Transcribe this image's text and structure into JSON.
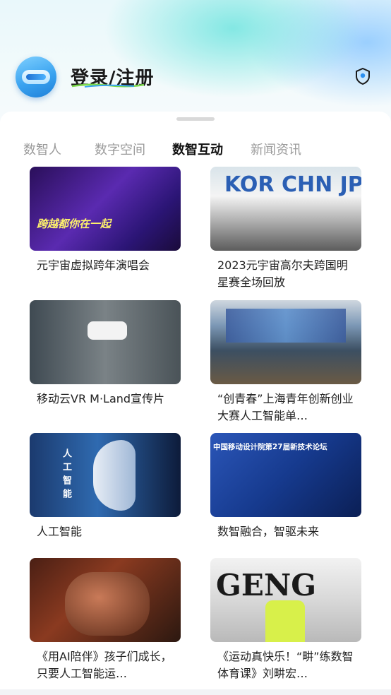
{
  "header": {
    "login_label": "登录/注册",
    "location_icon": "location-shield-icon",
    "avatar_icon": "vr-robot-avatar-icon"
  },
  "tabs": [
    {
      "label": "数智人",
      "active": false
    },
    {
      "label": "数字空间",
      "active": false
    },
    {
      "label": "数智互动",
      "active": true
    },
    {
      "label": "新闻资讯",
      "active": false
    }
  ],
  "cards": [
    {
      "title": "元宇宙虚拟跨年演唱会",
      "thumb_text": "跨越都你在一起"
    },
    {
      "title": "2023元宇宙高尔夫跨国明星赛全场回放",
      "thumb_text": "KOR  CHN  JPN"
    },
    {
      "title": "移动云VR M·Land宣传片",
      "thumb_text": ""
    },
    {
      "title": "“创青春”上海青年创新创业大赛人工智能单…",
      "thumb_text": ""
    },
    {
      "title": "人工智能",
      "thumb_text": "人工智能"
    },
    {
      "title": "数智融合，智驱未来",
      "thumb_text": "中国移动设计院第27届新技术论坛"
    },
    {
      "title": "《用AI陪伴》孩子们成长，只要人工智能运…",
      "thumb_text": ""
    },
    {
      "title": "《运动真快乐！“畊”练数智体育课》刘畊宏…",
      "thumb_text": "GENG"
    }
  ],
  "colors": {
    "active_tab": "#111111",
    "inactive_tab": "#9a9a9a",
    "accent_gradient": [
      "#3aa3f0",
      "#7ad9d2"
    ]
  }
}
